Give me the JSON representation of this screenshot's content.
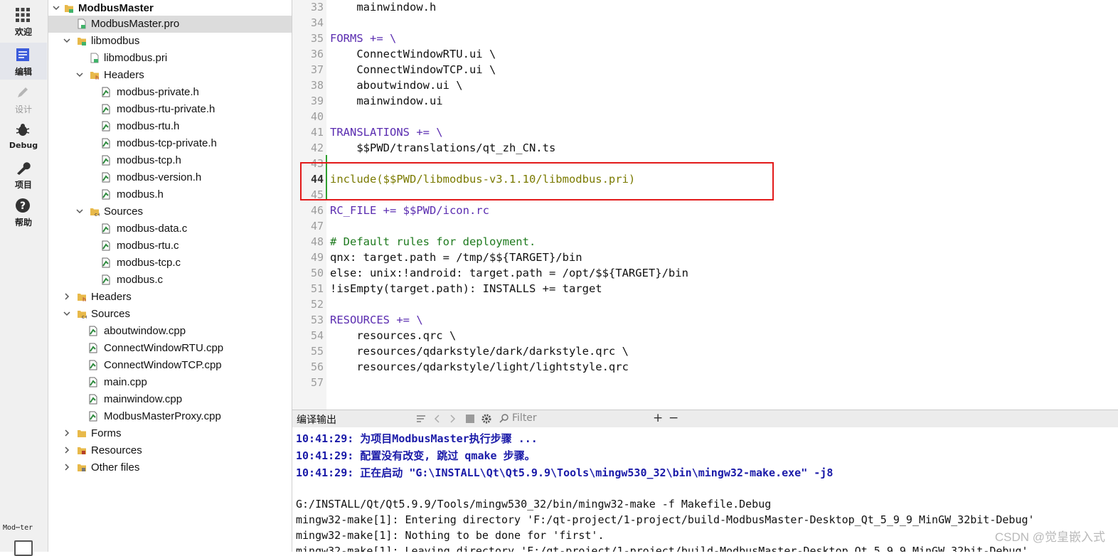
{
  "modebar": {
    "items": [
      {
        "label": "欢迎",
        "icon": "welcome-grid-icon"
      },
      {
        "label": "编辑",
        "icon": "edit-document-icon"
      },
      {
        "label": "设计",
        "icon": "design-pen-icon"
      },
      {
        "label": "Debug",
        "icon": "debug-bug-icon"
      },
      {
        "label": "项目",
        "icon": "project-wrench-icon"
      },
      {
        "label": "帮助",
        "icon": "help-question-icon"
      }
    ],
    "kit_label": "Mod⋯ter"
  },
  "tree": {
    "rows": [
      {
        "label": "ModbusMaster"
      },
      {
        "label": "ModbusMaster.pro"
      },
      {
        "label": "libmodbus"
      },
      {
        "label": "libmodbus.pri"
      },
      {
        "label": "Headers"
      },
      {
        "label": "modbus-private.h"
      },
      {
        "label": "modbus-rtu-private.h"
      },
      {
        "label": "modbus-rtu.h"
      },
      {
        "label": "modbus-tcp-private.h"
      },
      {
        "label": "modbus-tcp.h"
      },
      {
        "label": "modbus-version.h"
      },
      {
        "label": "modbus.h"
      },
      {
        "label": "Sources"
      },
      {
        "label": "modbus-data.c"
      },
      {
        "label": "modbus-rtu.c"
      },
      {
        "label": "modbus-tcp.c"
      },
      {
        "label": "modbus.c"
      },
      {
        "label": "Headers"
      },
      {
        "label": "Sources"
      },
      {
        "label": "aboutwindow.cpp"
      },
      {
        "label": "ConnectWindowRTU.cpp"
      },
      {
        "label": "ConnectWindowTCP.cpp"
      },
      {
        "label": "main.cpp"
      },
      {
        "label": "mainwindow.cpp"
      },
      {
        "label": "ModbusMasterProxy.cpp"
      },
      {
        "label": "Forms"
      },
      {
        "label": "Resources"
      },
      {
        "label": "Other files"
      }
    ]
  },
  "editor": {
    "current_line": "44",
    "lines": [
      {
        "n": "33",
        "t": "    mainwindow.h"
      },
      {
        "n": "34",
        "t": ""
      },
      {
        "n": "35",
        "t": "FORMS += \\"
      },
      {
        "n": "36",
        "t": "    ConnectWindowRTU.ui \\"
      },
      {
        "n": "37",
        "t": "    ConnectWindowTCP.ui \\"
      },
      {
        "n": "38",
        "t": "    aboutwindow.ui \\"
      },
      {
        "n": "39",
        "t": "    mainwindow.ui"
      },
      {
        "n": "40",
        "t": ""
      },
      {
        "n": "41",
        "t": "TRANSLATIONS += \\"
      },
      {
        "n": "42",
        "t": "    $$PWD/translations/qt_zh_CN.ts"
      },
      {
        "n": "43",
        "t": ""
      },
      {
        "n": "44",
        "t": "include($$PWD/libmodbus-v3.1.10/libmodbus.pri)"
      },
      {
        "n": "45",
        "t": ""
      },
      {
        "n": "46",
        "t": "RC_FILE += $$PWD/icon.rc"
      },
      {
        "n": "47",
        "t": ""
      },
      {
        "n": "48",
        "t": "# Default rules for deployment."
      },
      {
        "n": "49",
        "t": "qnx: target.path = /tmp/$${TARGET}/bin"
      },
      {
        "n": "50",
        "t": "else: unix:!android: target.path = /opt/$${TARGET}/bin"
      },
      {
        "n": "51",
        "t": "!isEmpty(target.path): INSTALLS += target"
      },
      {
        "n": "52",
        "t": ""
      },
      {
        "n": "53",
        "t": "RESOURCES += \\"
      },
      {
        "n": "54",
        "t": "    resources.qrc \\"
      },
      {
        "n": "55",
        "t": "    resources/qdarkstyle/dark/darkstyle.qrc \\"
      },
      {
        "n": "56",
        "t": "    resources/qdarkstyle/light/lightstyle.qrc"
      },
      {
        "n": "57",
        "t": ""
      }
    ]
  },
  "output": {
    "title": "编译输出",
    "filter_placeholder": "Filter",
    "add_label": "+",
    "remove_label": "−",
    "lines": [
      {
        "t": "10:41:29: 为项目ModbusMaster执行步骤 ...",
        "style": "blue"
      },
      {
        "t": "10:41:29: 配置没有改变, 跳过 qmake 步骤。",
        "style": "blue"
      },
      {
        "t": "10:41:29: 正在启动 \"G:\\INSTALL\\Qt\\Qt5.9.9\\Tools\\mingw530_32\\bin\\mingw32-make.exe\" -j8",
        "style": "blue"
      },
      {
        "t": "",
        "style": "norm"
      },
      {
        "t": "G:/INSTALL/Qt/Qt5.9.9/Tools/mingw530_32/bin/mingw32-make -f Makefile.Debug",
        "style": "norm"
      },
      {
        "t": "mingw32-make[1]: Entering directory 'F:/qt-project/1-project/build-ModbusMaster-Desktop_Qt_5_9_9_MinGW_32bit-Debug'",
        "style": "norm"
      },
      {
        "t": "mingw32-make[1]: Nothing to be done for 'first'.",
        "style": "norm"
      },
      {
        "t": "mingw32-make[1]: Leaving directory 'F:/qt-project/1-project/build-ModbusMaster-Desktop_Qt_5_9_9_MinGW_32bit-Debug'",
        "style": "norm"
      }
    ]
  },
  "watermark": "CSDN @觉皇嵌入式",
  "colors": {
    "accent": "#1a1aa8",
    "highlight": "#e21a1a",
    "keyword": "#5a2cb0"
  }
}
